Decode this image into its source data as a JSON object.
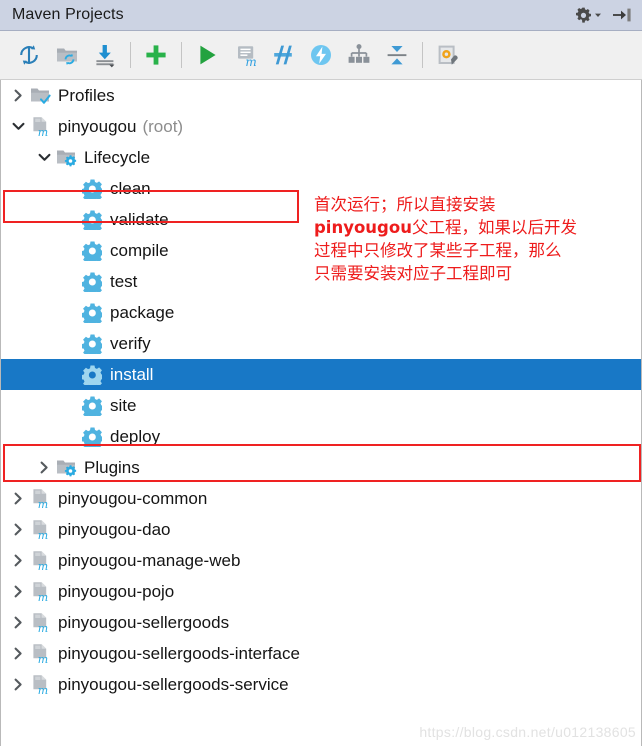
{
  "window": {
    "title": "Maven Projects",
    "title_actions": [
      {
        "name": "settings-gear-icon",
        "label": "Settings"
      },
      {
        "name": "hide-panel-icon",
        "label": "Hide"
      }
    ]
  },
  "toolbar": {
    "buttons": [
      {
        "name": "reimport-all-maven-projects-icon",
        "label": "Reimport All Maven Projects"
      },
      {
        "name": "generate-sources-and-update-folders-icon",
        "label": "Generate Sources and Update Folders For All Projects"
      },
      {
        "name": "download-sources-and-documentation-icon",
        "label": "Download Sources and/or Documentation"
      },
      {
        "name": "add-maven-project-icon",
        "label": "Add Maven Projects"
      },
      {
        "name": "run-maven-build-icon",
        "label": "Run Maven Build"
      },
      {
        "name": "execute-maven-goal-icon",
        "label": "Execute Maven Goal"
      },
      {
        "name": "toggle-skip-tests-icon",
        "label": "Toggle 'Skip Tests' Mode"
      },
      {
        "name": "toggle-offline-mode-icon",
        "label": "Toggle Offline Mode"
      },
      {
        "name": "show-dependencies-icon",
        "label": "Show Dependencies"
      },
      {
        "name": "collapse-all-icon",
        "label": "Collapse All"
      },
      {
        "name": "maven-settings-icon",
        "label": "Maven Settings"
      }
    ]
  },
  "tree": {
    "rows": [
      {
        "label": "Profiles",
        "suffix": "",
        "indent": 0,
        "twisty": "collapsed",
        "icon": "folder-check-icon",
        "selected": false
      },
      {
        "label": "pinyougou",
        "suffix": "(root)",
        "indent": 0,
        "twisty": "expanded",
        "icon": "maven-module-icon",
        "selected": false
      },
      {
        "label": "Lifecycle",
        "suffix": "",
        "indent": 1,
        "twisty": "expanded",
        "icon": "folder-gear-icon",
        "selected": false
      },
      {
        "label": "clean",
        "suffix": "",
        "indent": 2,
        "twisty": "none",
        "icon": "maven-goal-icon",
        "selected": false
      },
      {
        "label": "validate",
        "suffix": "",
        "indent": 2,
        "twisty": "none",
        "icon": "maven-goal-icon",
        "selected": false
      },
      {
        "label": "compile",
        "suffix": "",
        "indent": 2,
        "twisty": "none",
        "icon": "maven-goal-icon",
        "selected": false
      },
      {
        "label": "test",
        "suffix": "",
        "indent": 2,
        "twisty": "none",
        "icon": "maven-goal-icon",
        "selected": false
      },
      {
        "label": "package",
        "suffix": "",
        "indent": 2,
        "twisty": "none",
        "icon": "maven-goal-icon",
        "selected": false
      },
      {
        "label": "verify",
        "suffix": "",
        "indent": 2,
        "twisty": "none",
        "icon": "maven-goal-icon",
        "selected": false
      },
      {
        "label": "install",
        "suffix": "",
        "indent": 2,
        "twisty": "none",
        "icon": "maven-goal-icon",
        "selected": true
      },
      {
        "label": "site",
        "suffix": "",
        "indent": 2,
        "twisty": "none",
        "icon": "maven-goal-icon",
        "selected": false
      },
      {
        "label": "deploy",
        "suffix": "",
        "indent": 2,
        "twisty": "none",
        "icon": "maven-goal-icon",
        "selected": false
      },
      {
        "label": "Plugins",
        "suffix": "",
        "indent": 1,
        "twisty": "collapsed",
        "icon": "folder-gear-icon",
        "selected": false
      },
      {
        "label": "pinyougou-common",
        "suffix": "",
        "indent": 0,
        "twisty": "collapsed",
        "icon": "maven-module-icon",
        "selected": false
      },
      {
        "label": "pinyougou-dao",
        "suffix": "",
        "indent": 0,
        "twisty": "collapsed",
        "icon": "maven-module-icon",
        "selected": false
      },
      {
        "label": "pinyougou-manage-web",
        "suffix": "",
        "indent": 0,
        "twisty": "collapsed",
        "icon": "maven-module-icon",
        "selected": false
      },
      {
        "label": "pinyougou-pojo",
        "suffix": "",
        "indent": 0,
        "twisty": "collapsed",
        "icon": "maven-module-icon",
        "selected": false
      },
      {
        "label": "pinyougou-sellergoods",
        "suffix": "",
        "indent": 0,
        "twisty": "collapsed",
        "icon": "maven-module-icon",
        "selected": false
      },
      {
        "label": "pinyougou-sellergoods-interface",
        "suffix": "",
        "indent": 0,
        "twisty": "collapsed",
        "icon": "maven-module-icon",
        "selected": false
      },
      {
        "label": "pinyougou-sellergoods-service",
        "suffix": "",
        "indent": 0,
        "twisty": "collapsed",
        "icon": "maven-module-icon",
        "selected": false
      }
    ]
  },
  "annotation": {
    "line1": "首次运行；所以直接安装",
    "line2_bold": "pinyougou",
    "line2_rest": "父工程，如果以后开发",
    "line3": "过程中只修改了某些子工程，那么",
    "line4": "只需要安装对应子工程即可",
    "color": "#ee1c1c"
  },
  "highlights": {
    "root_box_target": "pinyougou (root)",
    "install_box_target": "install",
    "box_color": "#ef2222",
    "selection_color": "#1878c6"
  },
  "watermark": {
    "text": "https://blog.csdn.net/u012138605"
  }
}
